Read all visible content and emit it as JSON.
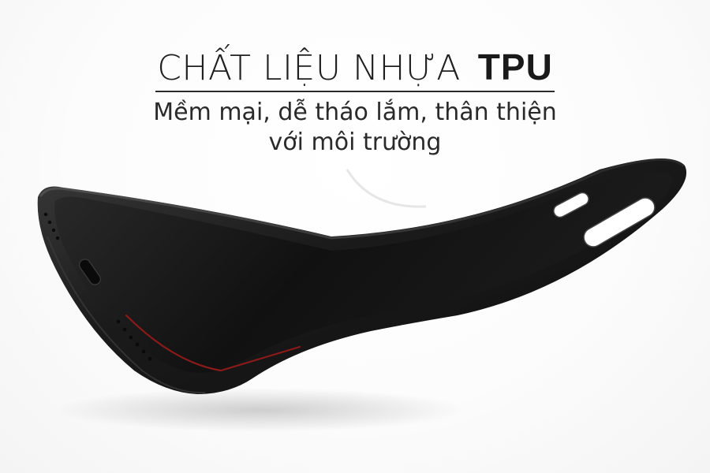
{
  "headline": {
    "title_light": "CHẤT LIỆU NHỰA",
    "title_bold": "TPU",
    "subtitle_line1": "Mềm mại, dễ tháo lắm, thân thiện",
    "subtitle_line2": "với môi trường"
  },
  "image": {
    "subject": "phone-case-icon",
    "case_color": "#1a1a1a",
    "accent_color": "#8b1a1a"
  }
}
